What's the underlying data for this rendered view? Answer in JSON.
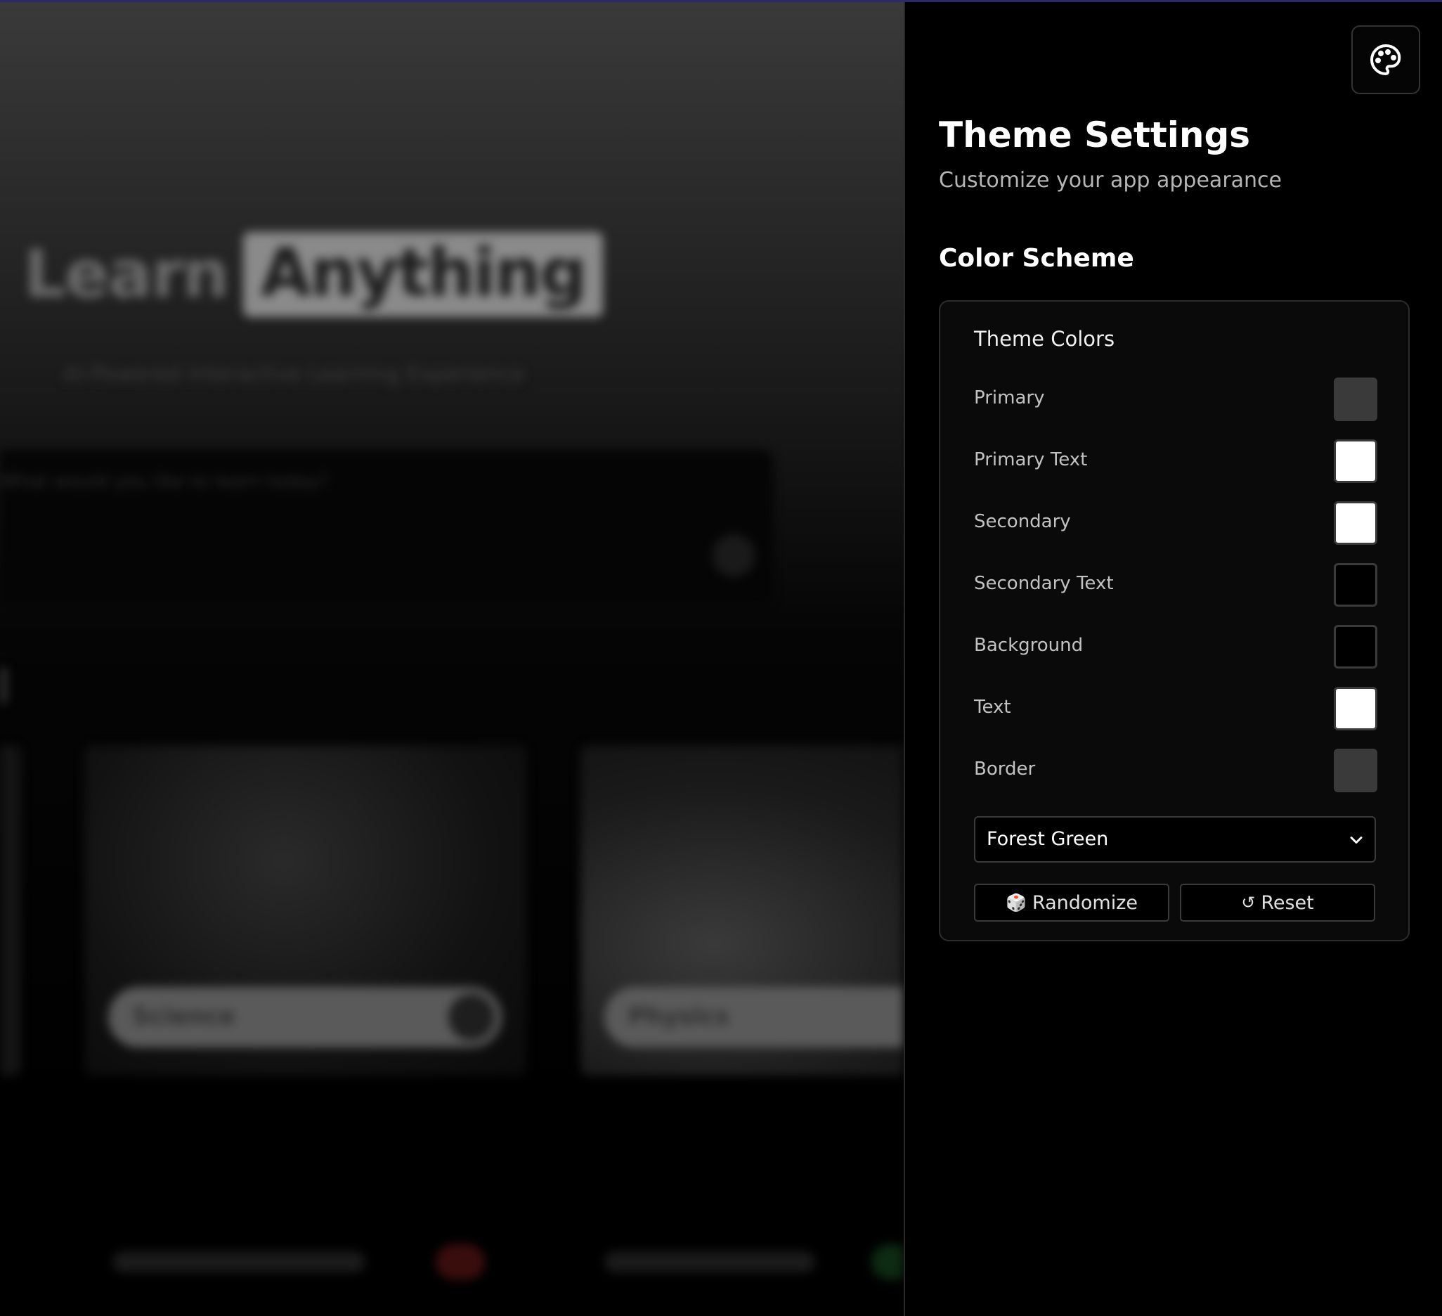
{
  "background_app": {
    "hero_word1": "Learn",
    "hero_word2": "Anything",
    "hero_subtitle": "AI-Powered Interactive Learning Experience",
    "search_placeholder": "What would you like to learn today?",
    "cards": [
      {
        "label": "Science"
      },
      {
        "label": "Physics"
      }
    ]
  },
  "panel": {
    "palette_icon": "palette-icon",
    "title": "Theme Settings",
    "subtitle": "Customize your app appearance",
    "section_title": "Color Scheme",
    "card_heading": "Theme Colors",
    "colors": [
      {
        "label": "Primary",
        "value": "#3a3a3a"
      },
      {
        "label": "Primary Text",
        "value": "#ffffff"
      },
      {
        "label": "Secondary",
        "value": "#ffffff"
      },
      {
        "label": "Secondary Text",
        "value": "#000000"
      },
      {
        "label": "Background",
        "value": "#000000"
      },
      {
        "label": "Text",
        "value": "#ffffff"
      },
      {
        "label": "Border",
        "value": "#3a3a3a"
      }
    ],
    "preset_select": {
      "selected": "Forest Green"
    },
    "randomize_icon": "🎲",
    "randomize_label": "Randomize",
    "reset_icon": "↺",
    "reset_label": "Reset"
  }
}
